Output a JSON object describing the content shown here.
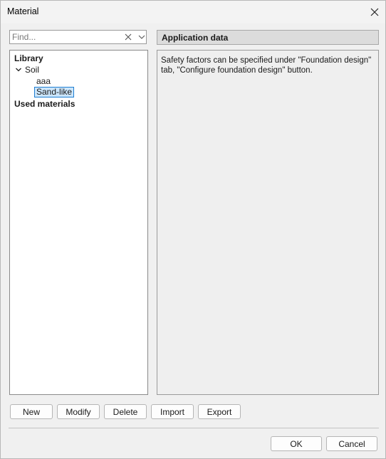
{
  "window": {
    "title": "Material"
  },
  "search": {
    "placeholder": "Find..."
  },
  "tree": {
    "library": "Library",
    "soil": "Soil",
    "aaa": "aaa",
    "sand_like": "Sand-like",
    "used_materials": "Used materials"
  },
  "application": {
    "header": "Application data",
    "text": "Safety factors can be specified under \"Foundation design\" tab, \"Configure foundation design\" button."
  },
  "buttons": {
    "new": "New",
    "modify": "Modify",
    "delete": "Delete",
    "import": "Import",
    "export": "Export",
    "ok": "OK",
    "cancel": "Cancel"
  },
  "colors": {
    "selection_border": "#1f7ed1",
    "selection_fill": "#cce6fb",
    "panel": "#efefef"
  }
}
